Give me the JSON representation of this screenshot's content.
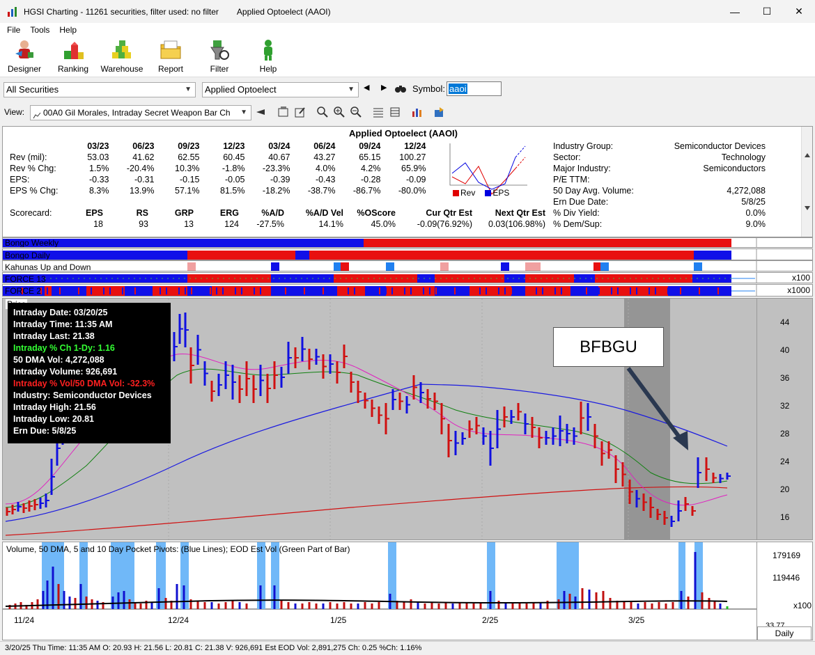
{
  "window": {
    "title": "HGSI Charting - 11261 securities, filter used: no filter",
    "subtitle": "Applied Optoelect (AAOI)",
    "minimize": "—",
    "maximize": "☐",
    "close": "✕"
  },
  "menu": [
    "File",
    "Tools",
    "Help"
  ],
  "toolbar": [
    "Designer",
    "Ranking",
    "Warehouse",
    "Report",
    "Filter",
    "Help"
  ],
  "selectors": {
    "universe": "All Securities",
    "security": "Applied Optoelect",
    "symbol_label": "Symbol:",
    "symbol_value": "aaoi"
  },
  "view": {
    "label": "View:",
    "value": "00A0 Gil Morales, Intraday Secret Weapon Bar Ch"
  },
  "fundamentals": {
    "title": "Applied Optoelect (AAOI)",
    "quarters": [
      "03/23",
      "06/23",
      "09/23",
      "12/23",
      "03/24",
      "06/24",
      "09/24",
      "12/24"
    ],
    "rows": [
      {
        "label": "Rev (mil):",
        "values": [
          "53.03",
          "41.62",
          "62.55",
          "60.45",
          "40.67",
          "43.27",
          "65.15",
          "100.27"
        ]
      },
      {
        "label": "Rev % Chg:",
        "values": [
          "1.5%",
          "-20.4%",
          "10.3%",
          "-1.8%",
          "-23.3%",
          "4.0%",
          "4.2%",
          "65.9%"
        ]
      },
      {
        "label": "EPS:",
        "values": [
          "-0.33",
          "-0.31",
          "-0.15",
          "-0.05",
          "-0.39",
          "-0.43",
          "-0.28",
          "-0.09"
        ]
      },
      {
        "label": "EPS % Chg:",
        "values": [
          "8.3%",
          "13.9%",
          "57.1%",
          "81.5%",
          "-18.2%",
          "-38.7%",
          "-86.7%",
          "-80.0%"
        ]
      }
    ],
    "scorecard": {
      "label": "Scorecard:",
      "headers": [
        "EPS",
        "RS",
        "GRP",
        "ERG",
        "%A/D",
        "%A/D Vel",
        "%OScore",
        "Cur Qtr Est",
        "Next Qtr Est"
      ],
      "values": [
        "18",
        "93",
        "13",
        "124",
        "-27.5%",
        "14.1%",
        "45.0%",
        "-0.09(76.92%)",
        "0.03(106.98%)"
      ]
    },
    "legend": {
      "rev": "Rev",
      "eps": "EPS",
      "rev_color": "#e00000",
      "eps_color": "#0000e0"
    },
    "info": [
      {
        "k": "Industry Group:",
        "v": "Semiconductor Devices"
      },
      {
        "k": "Sector:",
        "v": "Technology"
      },
      {
        "k": "Major Industry:",
        "v": "Semiconductors"
      },
      {
        "k": "P/E TTM:",
        "v": ""
      },
      {
        "k": "50 Day Avg. Volume:",
        "v": "4,272,088"
      },
      {
        "k": "Ern Due Date:",
        "v": "5/8/25"
      },
      {
        "k": "% Div Yield:",
        "v": "0.0%"
      },
      {
        "k": "% Dem/Sup:",
        "v": "9.0%"
      }
    ]
  },
  "indicators": {
    "bongo_weekly": "Bongo Weekly",
    "bongo_daily": "Bongo Daily",
    "kahunas": "Kahunas Up and Down",
    "force13": "FORCE 13",
    "force2": "FORCE 2",
    "force13_mult": "x100",
    "force2_mult": "x1000"
  },
  "price": {
    "label": "Price",
    "yticks": [
      "44",
      "40",
      "36",
      "32",
      "28",
      "24",
      "20",
      "16"
    ],
    "annotation": "BFBGU",
    "tooltip": [
      {
        "text": "Intraday Date: 03/20/25",
        "color": "#ffffff"
      },
      {
        "text": "Intraday Time: 11:35 AM",
        "color": "#ffffff"
      },
      {
        "text": "Intraday Last: 21.38",
        "color": "#ffffff"
      },
      {
        "text": "Intraday % Ch 1-Dy: 1.16",
        "color": "#33ff33"
      },
      {
        "text": "50 DMA Vol: 4,272,088",
        "color": "#ffffff"
      },
      {
        "text": "Intraday Volume: 926,691",
        "color": "#ffffff"
      },
      {
        "text": "Intraday % Vol/50 DMA Vol: -32.3%",
        "color": "#ff2020"
      },
      {
        "text": "Industry: Semiconductor Devices",
        "color": "#ffffff"
      },
      {
        "text": "Intraday High: 21.56",
        "color": "#ffffff"
      },
      {
        "text": "Intraday Low: 20.81",
        "color": "#ffffff"
      },
      {
        "text": "Ern Due: 5/8/25",
        "color": "#ffffff"
      }
    ]
  },
  "volume": {
    "label": "Volume, 50 DMA, 5 and 10 Day Pocket Pivots: (Blue Lines); EOD Est Vol (Green Part of Bar)",
    "yticks": [
      "179169",
      "119446"
    ],
    "mult": "x100",
    "xticks": [
      "11/24",
      "12/24",
      "1/25",
      "2/25",
      "3/25"
    ],
    "axis_value": "33.77"
  },
  "status": {
    "text": "3/20/25 Thu Time: 11:35 AM O: 20.93 H: 21.56 L: 20.81 C: 21.38 V: 926,691 Est EOD Vol: 2,891,275 Ch: 0.25 %Ch: 1.16%",
    "tab": "Daily",
    "value": "33.77"
  }
}
